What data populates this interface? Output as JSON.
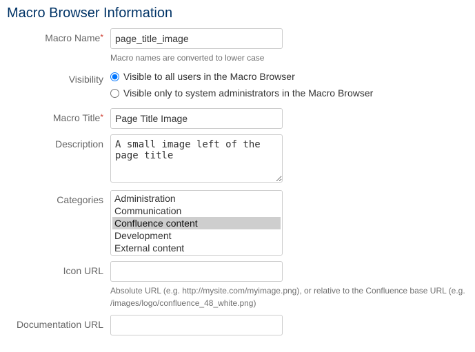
{
  "section": {
    "title": "Macro Browser Information"
  },
  "labels": {
    "macro_name": "Macro Name",
    "visibility": "Visibility",
    "macro_title": "Macro Title",
    "description": "Description",
    "categories": "Categories",
    "icon_url": "Icon URL",
    "documentation_url": "Documentation URL"
  },
  "fields": {
    "macro_name": {
      "value": "page_title_image",
      "hint": "Macro names are converted to lower case"
    },
    "visibility": {
      "option_all": "Visible to all users in the Macro Browser",
      "option_admin": "Visible only to system administrators in the Macro Browser"
    },
    "macro_title": {
      "value": "Page Title Image"
    },
    "description": {
      "value": "A small image left of the page title"
    },
    "categories": {
      "options": {
        "0": "Administration",
        "1": "Communication",
        "2": "Confluence content",
        "3": "Development",
        "4": "External content"
      }
    },
    "icon_url": {
      "value": "",
      "hint": "Absolute URL (e.g. http://mysite.com/myimage.png), or relative to the Confluence base URL (e.g. /images/logo/confluence_48_white.png)"
    },
    "documentation_url": {
      "value": ""
    }
  }
}
